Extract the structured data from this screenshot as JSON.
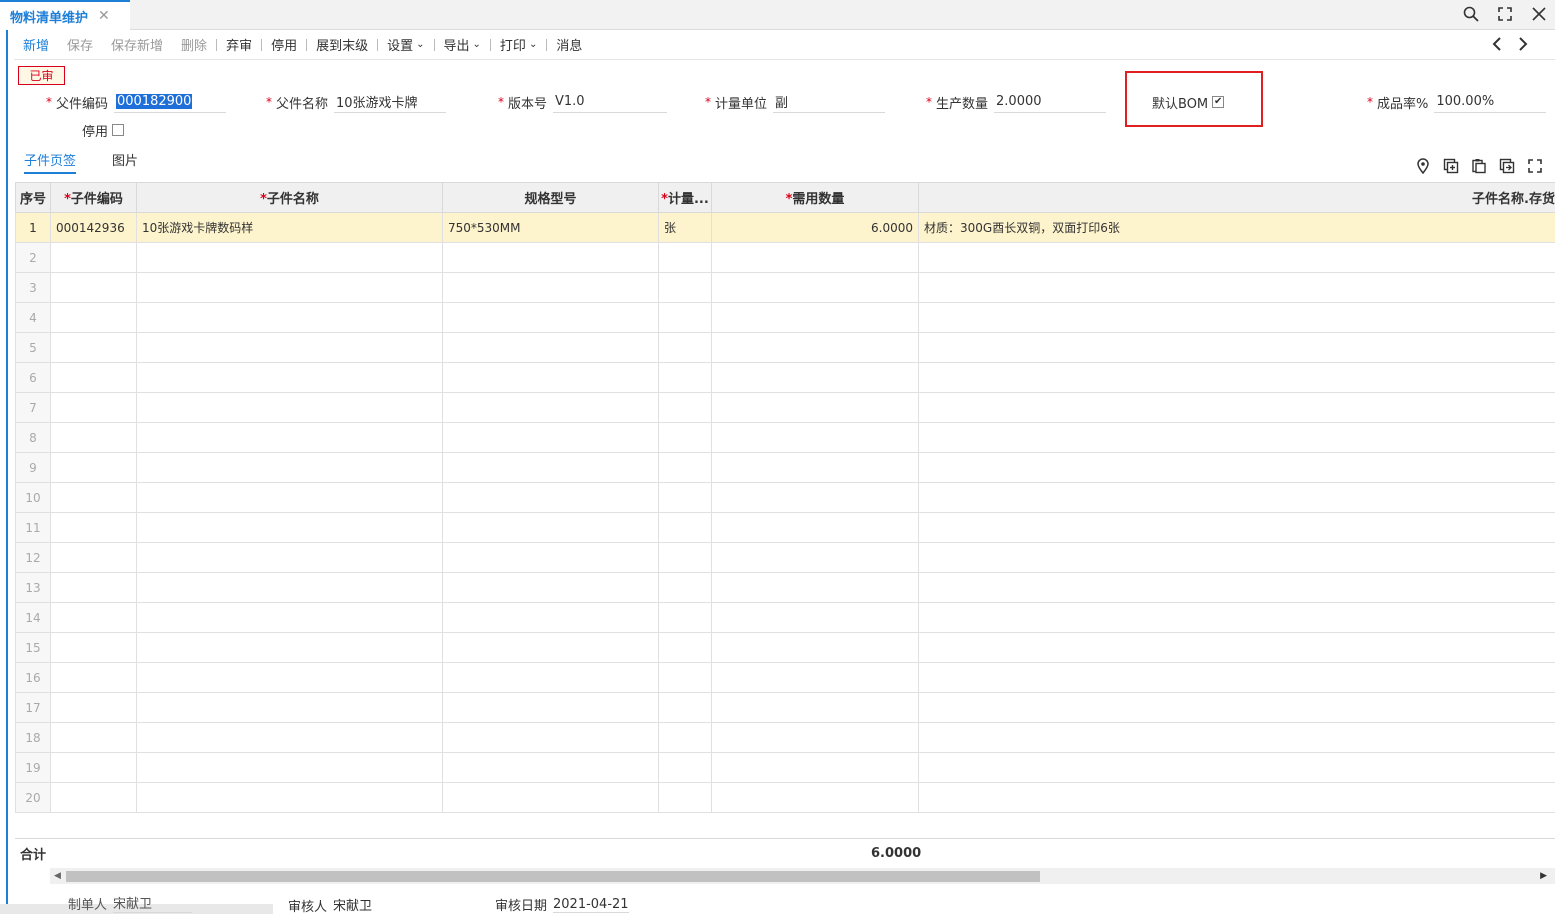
{
  "tab": {
    "title": "物料清单维护",
    "close": "✕"
  },
  "toolbar": {
    "new": "新增",
    "save": "保存",
    "save_new": "保存新增",
    "delete": "删除",
    "unaudit": "弃审",
    "disable": "停用",
    "expand": "展到末级",
    "settings": "设置",
    "export": "导出",
    "print": "打印",
    "message": "消息"
  },
  "status": "已审",
  "form": {
    "parent_code": {
      "label": "父件编码",
      "value": "000182900"
    },
    "parent_name": {
      "label": "父件名称",
      "value": "10张游戏卡牌"
    },
    "version": {
      "label": "版本号",
      "value": "V1.0"
    },
    "unit": {
      "label": "计量单位",
      "value": "副"
    },
    "qty": {
      "label": "生产数量",
      "value": "2.0000"
    },
    "default_bom": {
      "label": "默认BOM",
      "checked": true
    },
    "yield": {
      "label": "成品率%",
      "value": "100.00%"
    },
    "disabled": {
      "label": "停用",
      "checked": false
    }
  },
  "subtabs": [
    "子件页签",
    "图片"
  ],
  "grid": {
    "headers": [
      "序号",
      "子件编码",
      "子件名称",
      "规格型号",
      "计量...",
      "需用数量",
      "子件名称.存货"
    ],
    "rows": [
      [
        "1",
        "000142936",
        "10张游戏卡牌数码样",
        "750*530MM",
        "张",
        "6.0000",
        "材质：300G酉长双铜，双面打印6张"
      ]
    ],
    "row_numbers": [
      "2",
      "3",
      "4",
      "5",
      "6",
      "7",
      "8",
      "9",
      "10",
      "11",
      "12",
      "13",
      "14",
      "15",
      "16",
      "17",
      "18",
      "19",
      "20"
    ]
  },
  "totals": {
    "label": "合计",
    "value": "6.0000"
  },
  "footer": {
    "maker": {
      "label": "制单人",
      "value": "宋献卫"
    },
    "auditor": {
      "label": "审核人",
      "value": "宋献卫"
    },
    "audit_date": {
      "label": "审核日期",
      "value": "2021-04-21"
    }
  }
}
